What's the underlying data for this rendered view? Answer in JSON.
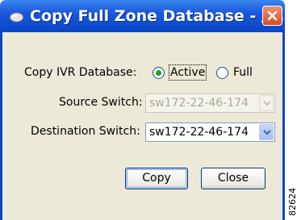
{
  "window": {
    "title": "Copy Full Zone Database - /...",
    "title_icon": "app-icon",
    "close_icon": "close-icon"
  },
  "form": {
    "copy_ivr_label": "Copy IVR Database:",
    "radio_active_label": "Active",
    "radio_full_label": "Full",
    "radio_selected": "Active",
    "source_switch_label": "Source Switch:",
    "source_switch_value": "sw172-22-46-174",
    "source_switch_enabled": false,
    "destination_switch_label": "Destination Switch:",
    "destination_switch_value": "sw172-22-46-174"
  },
  "buttons": {
    "copy_label": "Copy",
    "close_label": "Close"
  },
  "figure_id": "82624",
  "colors": {
    "titlebar": "#0a46c8",
    "dialog_bg": "#ece9d8",
    "close_button": "#d84a22",
    "radio_dot": "#21a121"
  }
}
